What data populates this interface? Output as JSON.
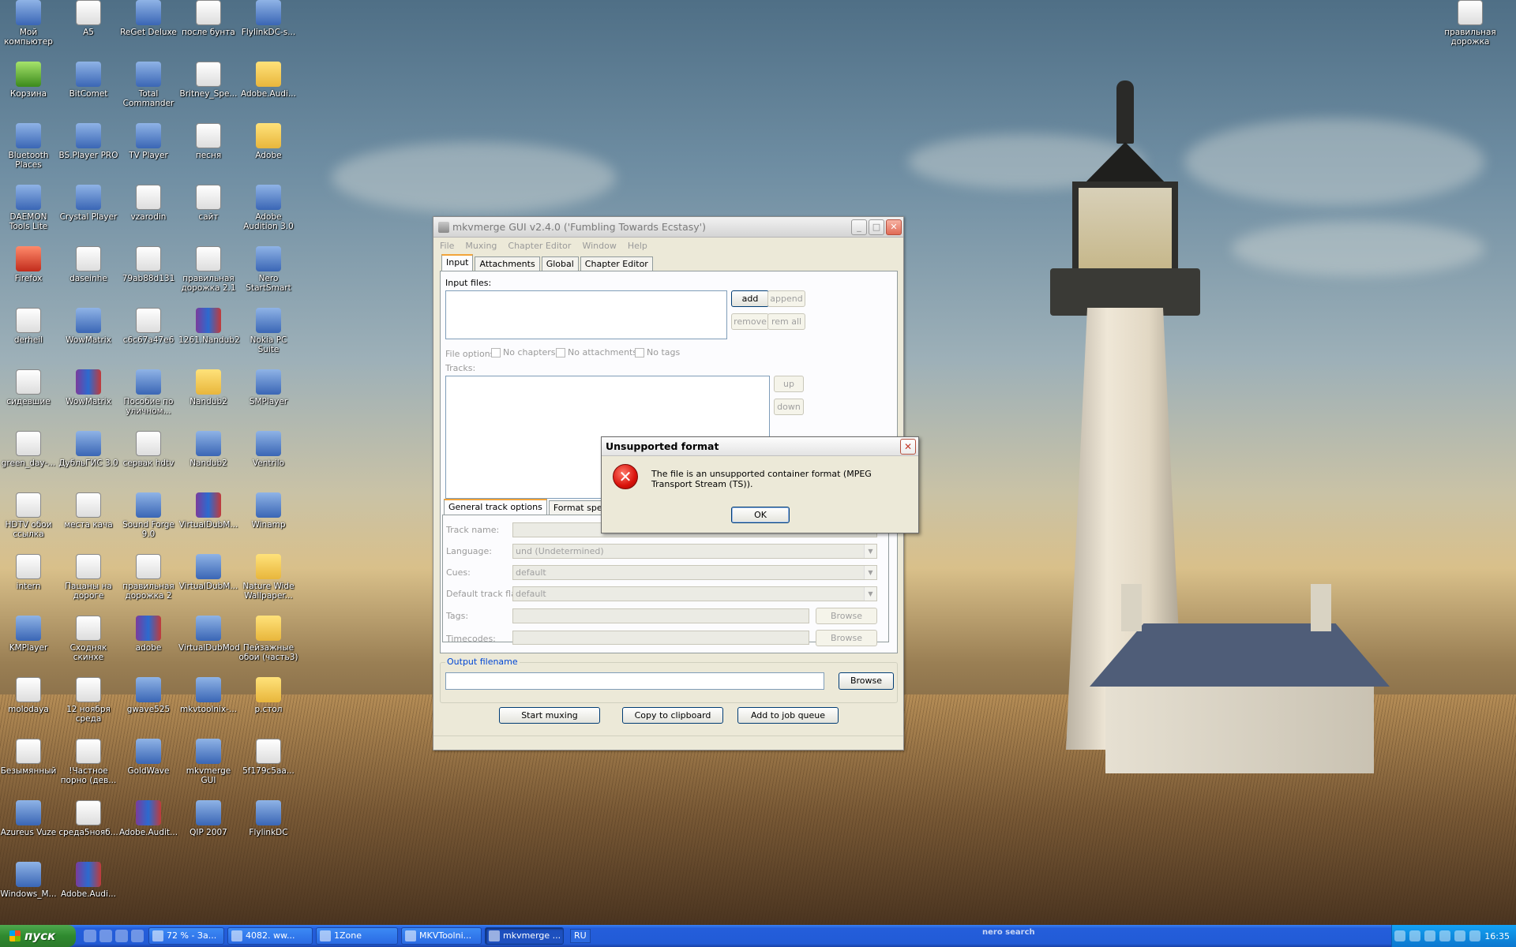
{
  "desktop": {
    "icons": [
      {
        "label": "Мой компьютер",
        "glyph": "computer-icon"
      },
      {
        "label": "A5",
        "glyph": "file-icon"
      },
      {
        "label": "ReGet Deluxe",
        "glyph": "app-icon"
      },
      {
        "label": "после бунта",
        "glyph": "video-icon"
      },
      {
        "label": "FlylinkDC-s...",
        "glyph": "app-icon"
      },
      {
        "label": "Корзина",
        "glyph": "recycle-bin-icon"
      },
      {
        "label": "BitComet",
        "glyph": "app-icon"
      },
      {
        "label": "Total Commander",
        "glyph": "app-icon"
      },
      {
        "label": "Britney_Spe...",
        "glyph": "video-icon"
      },
      {
        "label": "Adobe.Audi...",
        "glyph": "folder-icon"
      },
      {
        "label": "Bluetooth Places",
        "glyph": "bluetooth-icon"
      },
      {
        "label": "BS.Player PRO",
        "glyph": "app-icon"
      },
      {
        "label": "TV Player",
        "glyph": "app-icon"
      },
      {
        "label": "песня",
        "glyph": "video-icon"
      },
      {
        "label": "Adobe",
        "glyph": "folder-icon"
      },
      {
        "label": "DAEMON Tools Lite",
        "glyph": "app-icon"
      },
      {
        "label": "Crystal Player",
        "glyph": "app-icon"
      },
      {
        "label": "vzarodin",
        "glyph": "file-icon"
      },
      {
        "label": "сайт",
        "glyph": "file-icon"
      },
      {
        "label": "Adobe Audition 3.0",
        "glyph": "app-icon"
      },
      {
        "label": "Firefox",
        "glyph": "firefox-icon"
      },
      {
        "label": "daseinhe",
        "glyph": "file-icon"
      },
      {
        "label": "79ab88d131",
        "glyph": "file-icon"
      },
      {
        "label": "правильная дорожка 2.1",
        "glyph": "file-icon"
      },
      {
        "label": "Nero StartSmart",
        "glyph": "app-icon"
      },
      {
        "label": "derheil",
        "glyph": "file-icon"
      },
      {
        "label": "WowMatrix",
        "glyph": "app-icon"
      },
      {
        "label": "c6c67a47e6",
        "glyph": "file-icon"
      },
      {
        "label": "1261.Nandub2",
        "glyph": "archive-icon"
      },
      {
        "label": "Nokia PC Suite",
        "glyph": "app-icon"
      },
      {
        "label": "сидевшие",
        "glyph": "image-icon"
      },
      {
        "label": "WowMatrix",
        "glyph": "archive-icon"
      },
      {
        "label": "Пособие по уличном...",
        "glyph": "app-icon"
      },
      {
        "label": "Nandub2",
        "glyph": "folder-icon"
      },
      {
        "label": "SMPlayer",
        "glyph": "app-icon"
      },
      {
        "label": "green_day-...",
        "glyph": "video-icon"
      },
      {
        "label": "ДубльГИС 3.0",
        "glyph": "app-icon"
      },
      {
        "label": "сервак hdtv",
        "glyph": "file-icon"
      },
      {
        "label": "Nandub2",
        "glyph": "app-icon"
      },
      {
        "label": "Ventrilo",
        "glyph": "app-icon"
      },
      {
        "label": "HDTV обои ссылка",
        "glyph": "file-icon"
      },
      {
        "label": "места кача",
        "glyph": "image-icon"
      },
      {
        "label": "Sound Forge 9.0",
        "glyph": "app-icon"
      },
      {
        "label": "VirtualDubM...",
        "glyph": "archive-icon"
      },
      {
        "label": "Winamp",
        "glyph": "app-icon"
      },
      {
        "label": "intern",
        "glyph": "file-icon"
      },
      {
        "label": "Пацаны на дороге",
        "glyph": "video-icon"
      },
      {
        "label": "правильная дорожка 2",
        "glyph": "file-icon"
      },
      {
        "label": "VirtualDubM...",
        "glyph": "app-icon"
      },
      {
        "label": "Nature Wide Wallpaper...",
        "glyph": "folder-icon"
      },
      {
        "label": "KMPlayer",
        "glyph": "app-icon"
      },
      {
        "label": "Сходняк скинхе",
        "glyph": "video-icon"
      },
      {
        "label": "adobe",
        "glyph": "archive-icon"
      },
      {
        "label": "VirtualDubMod",
        "glyph": "app-icon"
      },
      {
        "label": "Пейзажные обои (часть3)",
        "glyph": "folder-icon"
      },
      {
        "label": "molodaya",
        "glyph": "file-icon"
      },
      {
        "label": "12 ноября среда",
        "glyph": "file-icon"
      },
      {
        "label": "gwave525",
        "glyph": "app-icon"
      },
      {
        "label": "mkvtoolnix-...",
        "glyph": "app-icon"
      },
      {
        "label": "р.стол",
        "glyph": "folder-icon"
      },
      {
        "label": "Безымянный",
        "glyph": "image-icon"
      },
      {
        "label": "!Частное порно (дев...",
        "glyph": "video-icon"
      },
      {
        "label": "GoldWave",
        "glyph": "app-icon"
      },
      {
        "label": "mkvmerge GUI",
        "glyph": "app-icon"
      },
      {
        "label": "5f179c5aa...",
        "glyph": "file-icon"
      },
      {
        "label": "Azureus Vuze",
        "glyph": "app-icon"
      },
      {
        "label": "среда5нояб...",
        "glyph": "file-icon"
      },
      {
        "label": "Adobe.Audit...",
        "glyph": "archive-icon"
      },
      {
        "label": "QIP 2007",
        "glyph": "app-icon"
      },
      {
        "label": "FlylinkDC",
        "glyph": "app-icon"
      },
      {
        "label": "Windows_M...",
        "glyph": "app-icon"
      },
      {
        "label": "Adobe.Audi...",
        "glyph": "archive-icon"
      },
      {
        "label": "правильная дорожка",
        "glyph": "file-icon"
      }
    ]
  },
  "mkvmerge": {
    "title": "mkvmerge GUI v2.4.0 ('Fumbling Towards Ecstasy')",
    "menu": [
      "File",
      "Muxing",
      "Chapter Editor",
      "Window",
      "Help"
    ],
    "tabs": [
      "Input",
      "Attachments",
      "Global",
      "Chapter Editor"
    ],
    "input_files_label": "Input files:",
    "buttons": {
      "add": "add",
      "append": "append",
      "remove": "remove",
      "rem_all": "rem all",
      "up": "up",
      "down": "down"
    },
    "file_options_label": "File options:",
    "file_options": [
      "No chapters",
      "No attachments",
      "No tags"
    ],
    "tracks_label": "Tracks:",
    "subtabs": [
      "General track options",
      "Format specific"
    ],
    "track_name_label": "Track name:",
    "language_label": "Language:",
    "language_value": "und (Undetermined)",
    "cues_label": "Cues:",
    "cues_value": "default",
    "default_flag_label": "Default track flag:",
    "default_flag_value": "default",
    "tags_label": "Tags:",
    "timecodes_label": "Timecodes:",
    "browse": "Browse",
    "output_label": "Output filename",
    "output_browse": "Browse",
    "start_muxing": "Start muxing",
    "copy_clipboard": "Copy to clipboard",
    "add_job_queue": "Add to job queue"
  },
  "dialog": {
    "title": "Unsupported format",
    "message": "The file is an unsupported container format (MPEG Transport Stream (TS)).",
    "ok": "OK",
    "icon": "error-icon"
  },
  "taskbar": {
    "start": "пуск",
    "buttons": [
      {
        "label": "72 % - За...",
        "active": false
      },
      {
        "label": "4082. ww...",
        "active": false
      },
      {
        "label": "1Zone",
        "active": false
      },
      {
        "label": "MKVToolni...",
        "active": false
      },
      {
        "label": "mkvmerge ...",
        "active": true
      }
    ],
    "language": "RU",
    "nero_label": "nero search",
    "clock": "16:35"
  },
  "colors": {
    "taskbar_blue": "#245edb",
    "start_green": "#2f8a2f",
    "tray_blue": "#0f8cdf",
    "error_red": "#d9120b"
  }
}
